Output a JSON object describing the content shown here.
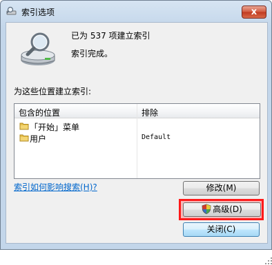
{
  "window": {
    "title": "索引选项",
    "close_glyph": "x"
  },
  "summary": {
    "count_text": "已为 537 项建立索引",
    "status_text": "索引完成。"
  },
  "locations": {
    "heading": "为这些位置建立索引:",
    "columns": [
      "包含的位置",
      "排除"
    ],
    "rows": [
      {
        "name": "「开始」菜单",
        "exclude": ""
      },
      {
        "name": "用户",
        "exclude": "Default"
      }
    ]
  },
  "help_link": "索引如何影响搜索(H)?",
  "buttons": {
    "modify": "修改(M)",
    "advanced": "高级(D)",
    "close": "关闭(C)"
  },
  "colors": {
    "highlight": "#ff1a1a",
    "link": "#0066cc"
  },
  "icons": {
    "title": "search-drive-icon",
    "main": "indexing-drive-magnifier-icon",
    "folder": "folder-icon",
    "shield": "uac-shield-icon"
  }
}
